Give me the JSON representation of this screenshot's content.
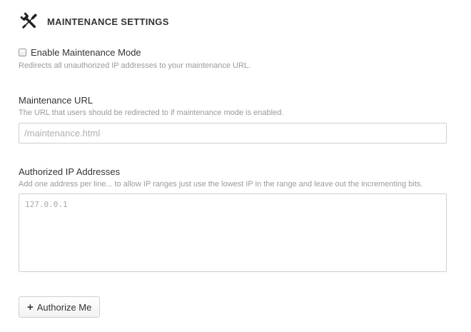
{
  "header": {
    "icon": "tools-icon",
    "title": "MAINTENANCE SETTINGS"
  },
  "enable": {
    "label": "Enable Maintenance Mode",
    "checked": false,
    "help": "Redirects all unauthorized IP addresses to your maintenance URL."
  },
  "url": {
    "label": "Maintenance URL",
    "help": "The URL that users should be redirected to if maintenance mode is enabled.",
    "placeholder": "/maintenance.html",
    "value": ""
  },
  "ips": {
    "label": "Authorized IP Addresses",
    "help": "Add one address per line... to allow IP ranges just use the lowest IP in the range and leave out the incrementing bits.",
    "placeholder": "127.0.0.1",
    "value": ""
  },
  "authorize_button": {
    "icon": "plus-icon",
    "label": "Authorize Me"
  }
}
